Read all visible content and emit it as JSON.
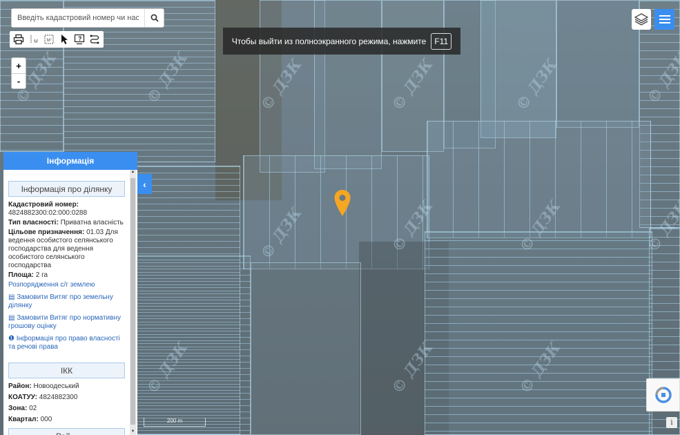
{
  "search": {
    "placeholder": "Введіть кадастровий номер чи населений пункт"
  },
  "toolbar": {
    "tools": [
      "printer-icon",
      "measure-line-icon",
      "measure-area-icon",
      "cursor-icon",
      "identify-icon",
      "route-icon"
    ],
    "measure_line_label": "M",
    "measure_area_label": "M²"
  },
  "zoom": {
    "in": "+",
    "out": "-"
  },
  "fullscreen_hint": {
    "text": "Чтобы выйти из полноэкранного режима, нажмите",
    "key": "F11"
  },
  "watermark": "© ДЗК",
  "panel": {
    "header": "Інформація",
    "parcel_section": {
      "title": "Інформація про ділянку",
      "cadastral_label": "Кадастровий номер:",
      "cadastral_value": "4824882300:02:000:0288",
      "ownership_label": "Тип власності:",
      "ownership_value": "Приватна власність",
      "purpose_label": "Цільове призначення:",
      "purpose_value": "01.03 Для ведення особистого селянського господарства для ведення особистого селянського господарства",
      "area_label": "Площа:",
      "area_value": "2 га",
      "links": [
        "Розпорядження с/г землею",
        "Замовити Витяг про земельну ділянку",
        "Замовити Витяг про нормативну грошову оцінку",
        "Інформація про право власності та речові права"
      ]
    },
    "ikk_section": {
      "title": "ІКК",
      "district_label": "Район:",
      "district_value": "Новоодеський",
      "koatuu_label": "КОАТУУ:",
      "koatuu_value": "4824882300",
      "zone_label": "Зона:",
      "zone_value": "02",
      "quarter_label": "Квартал:",
      "quarter_value": "000"
    },
    "next_section_partial": "Рай..."
  },
  "scale": {
    "label": "200 m"
  },
  "colors": {
    "accent": "#3a8ef0",
    "marker": "#f5a623",
    "link": "#2966b8"
  }
}
